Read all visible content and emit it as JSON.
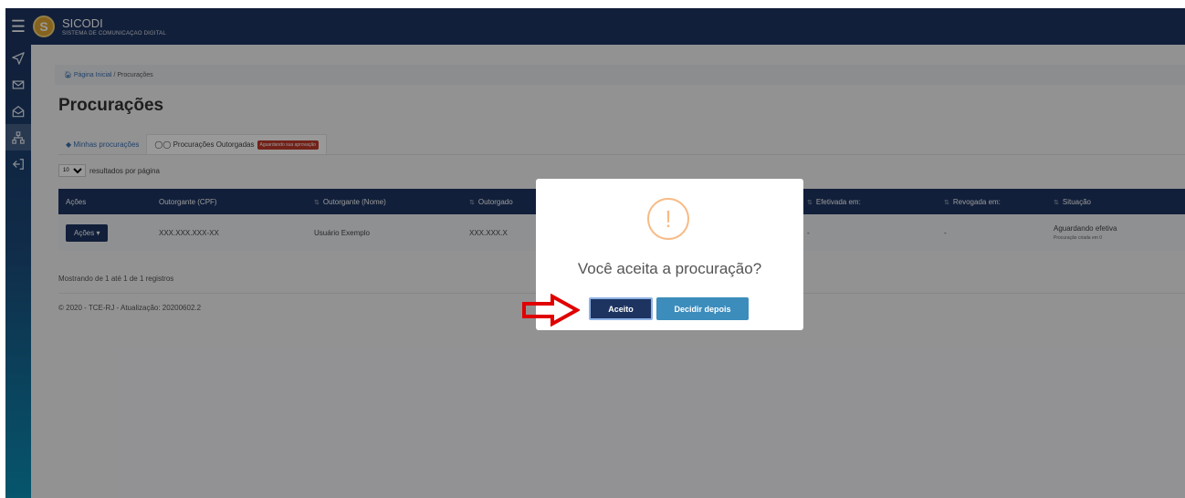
{
  "app": {
    "title": "SICODI",
    "subtitle": "SISTEMA DE COMUNICAÇÃO DIGITAL",
    "logo_letter": "S"
  },
  "sidebar": {
    "items": [
      {
        "icon": "send-icon"
      },
      {
        "icon": "envelope-icon"
      },
      {
        "icon": "open-envelope-icon"
      },
      {
        "icon": "sitemap-icon",
        "active": true
      },
      {
        "icon": "sign-out-icon"
      }
    ]
  },
  "breadcrumb": {
    "home": "Página Inicial",
    "separator": "/",
    "current": "Procurações"
  },
  "page": {
    "title": "Procurações"
  },
  "tabs": [
    {
      "label": "Minhas procurações"
    },
    {
      "label": "Procurações Outorgadas",
      "badge": "Aguardando sua aprovação"
    }
  ],
  "per_page": {
    "value": "10",
    "label": "resultados por página"
  },
  "table": {
    "headers": [
      "Ações",
      "Outorgante (CPF)",
      "Outorgante (Nome)",
      "Outorgado",
      "Efetivada em:",
      "Revogada em:",
      "Situação"
    ],
    "row": {
      "acoes": "Ações",
      "cpf": "XXX.XXX.XXX-XX",
      "nome": "Usuário Exemplo",
      "outorgado": "XXX.XXX.X",
      "efetivada": "-",
      "revogada": "-",
      "situacao": "Aguardando efetiva",
      "situacao_detail": "Procuração criada em 0"
    }
  },
  "showing": "Mostrando de 1 até 1 de 1 registros",
  "footer": "© 2020 - TCE-RJ - Atualização: 20200602.2",
  "modal": {
    "icon_glyph": "!",
    "title": "Você aceita a procuração?",
    "accept_label": "Aceito",
    "later_label": "Decidir depois"
  },
  "colors": {
    "navy": "#1d3461",
    "accent_blue": "#3c8dbc",
    "warning": "#f8bb86",
    "badge_red": "#c0392b",
    "arrow_red": "#e00000"
  }
}
